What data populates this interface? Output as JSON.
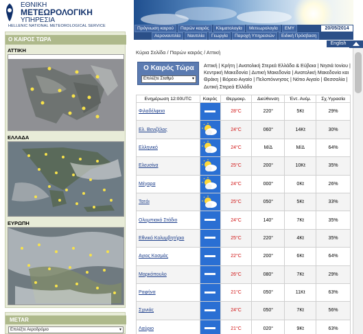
{
  "logo": {
    "line1": "ΕΘΝΙΚΗ",
    "line2": "ΜΕΤΕΩΡΟΛΟΓΙΚΗ",
    "line3": "ΥΠΗΡΕΣΙΑ",
    "line4": "HELLENIC NATIONAL METEOROLOGICAL SERVICE"
  },
  "nav": {
    "row1": [
      "Πρόγνωση καιρού",
      "Παρών καιρός",
      "Κλιματολογία",
      "Μετεωρολογία",
      "ΕΜΥ"
    ],
    "row2": [
      "Αεροναυτιλία",
      "Ναυτιλία",
      "Γεωργία",
      "Παροχή Υπηρεσιών",
      "Ειδική Πρόσβαση"
    ],
    "date": "20/05/2014",
    "english": "English"
  },
  "left": {
    "title": "Ο ΚΑΙΡΟΣ ΤΩΡΑ",
    "regions": [
      "ΑΤΤΙΚΗ",
      "ΕΛΛΑΔΑ",
      "ΕΥΡΩΠΗ"
    ],
    "metar_title": "METAR",
    "metar_select": "Επιλέξτε Αεροδρόμιο"
  },
  "breadcrumb": "Κύρια Σελίδα / Παρών καιρός / Αττική",
  "now": {
    "title": "Ο Καιρός Τώρα",
    "station_select": "Επιλέξτε Σταθμό"
  },
  "regions_text": "Αττική | Κρήτη | Ανατολική Στερεά Ελλάδα & Εύβοια | Νησιά Ιονίου | Κεντρική Μακεδονία | Δυτική Μακεδονία | Ανατολική Μακεδονία και Θράκη | Βόρειο Αιγαίο | Πελοπόννησος | Νότιο Αιγαίο | Θεσσαλία | Δυτική Στερεά Ελλάδα",
  "table": {
    "headers": [
      "Ενημέρωση 12:00UTC",
      "Καιρός",
      "Θερμοκρ.",
      "Διεύθυνση",
      "Έντ. Ανέμ.",
      "Σχ.Υγρασία"
    ],
    "rows": [
      {
        "station": "Φιλαδέλφεια",
        "wx": "clear",
        "temp": "28°C",
        "dir": "220°",
        "wind": "5Kt",
        "rh": "29%"
      },
      {
        "station": "Ελ. Βενιζέλος",
        "wx": "partly-cloudy",
        "temp": "24°C",
        "dir": "060°",
        "wind": "14Kt",
        "rh": "30%"
      },
      {
        "station": "Ελληνικό",
        "wx": "partly-cloudy",
        "temp": "24°C",
        "dir": "Μ/Δ",
        "wind": "Μ/Δ",
        "rh": "64%"
      },
      {
        "station": "Ελευσίνα",
        "wx": "partly-cloudy",
        "temp": "25°C",
        "dir": "200°",
        "wind": "10Kt",
        "rh": "35%"
      },
      {
        "station": "Μέγαρα",
        "wx": "partly-cloudy",
        "temp": "24°C",
        "dir": "000°",
        "wind": "0Kt",
        "rh": "26%"
      },
      {
        "station": "Τατόι",
        "wx": "partly-cloudy",
        "temp": "25°C",
        "dir": "050°",
        "wind": "5Kt",
        "rh": "33%"
      },
      {
        "station": "Ολυμπιακό Στάδιο",
        "wx": "clear",
        "temp": "24°C",
        "dir": "140°",
        "wind": "7Kt",
        "rh": "35%"
      },
      {
        "station": "Εθνικό Κολυμβητήριο",
        "wx": "clear",
        "temp": "25°C",
        "dir": "220°",
        "wind": "4Kt",
        "rh": "35%"
      },
      {
        "station": "Αγιος Κοσμάς",
        "wx": "clear",
        "temp": "22°C",
        "dir": "200°",
        "wind": "6Kt",
        "rh": "64%"
      },
      {
        "station": "Μαρκόπουλο",
        "wx": "clear",
        "temp": "26°C",
        "dir": "080°",
        "wind": "7Kt",
        "rh": "29%"
      },
      {
        "station": "Ραφήνα",
        "wx": "clear",
        "temp": "21°C",
        "dir": "050°",
        "wind": "11Kt",
        "rh": "63%"
      },
      {
        "station": "Σχινιάς",
        "wx": "clear",
        "temp": "24°C",
        "dir": "050°",
        "wind": "7Kt",
        "rh": "56%"
      },
      {
        "station": "Λαύριο",
        "wx": "clear",
        "temp": "21°C",
        "dir": "020°",
        "wind": "9Kt",
        "rh": "63%"
      }
    ]
  }
}
